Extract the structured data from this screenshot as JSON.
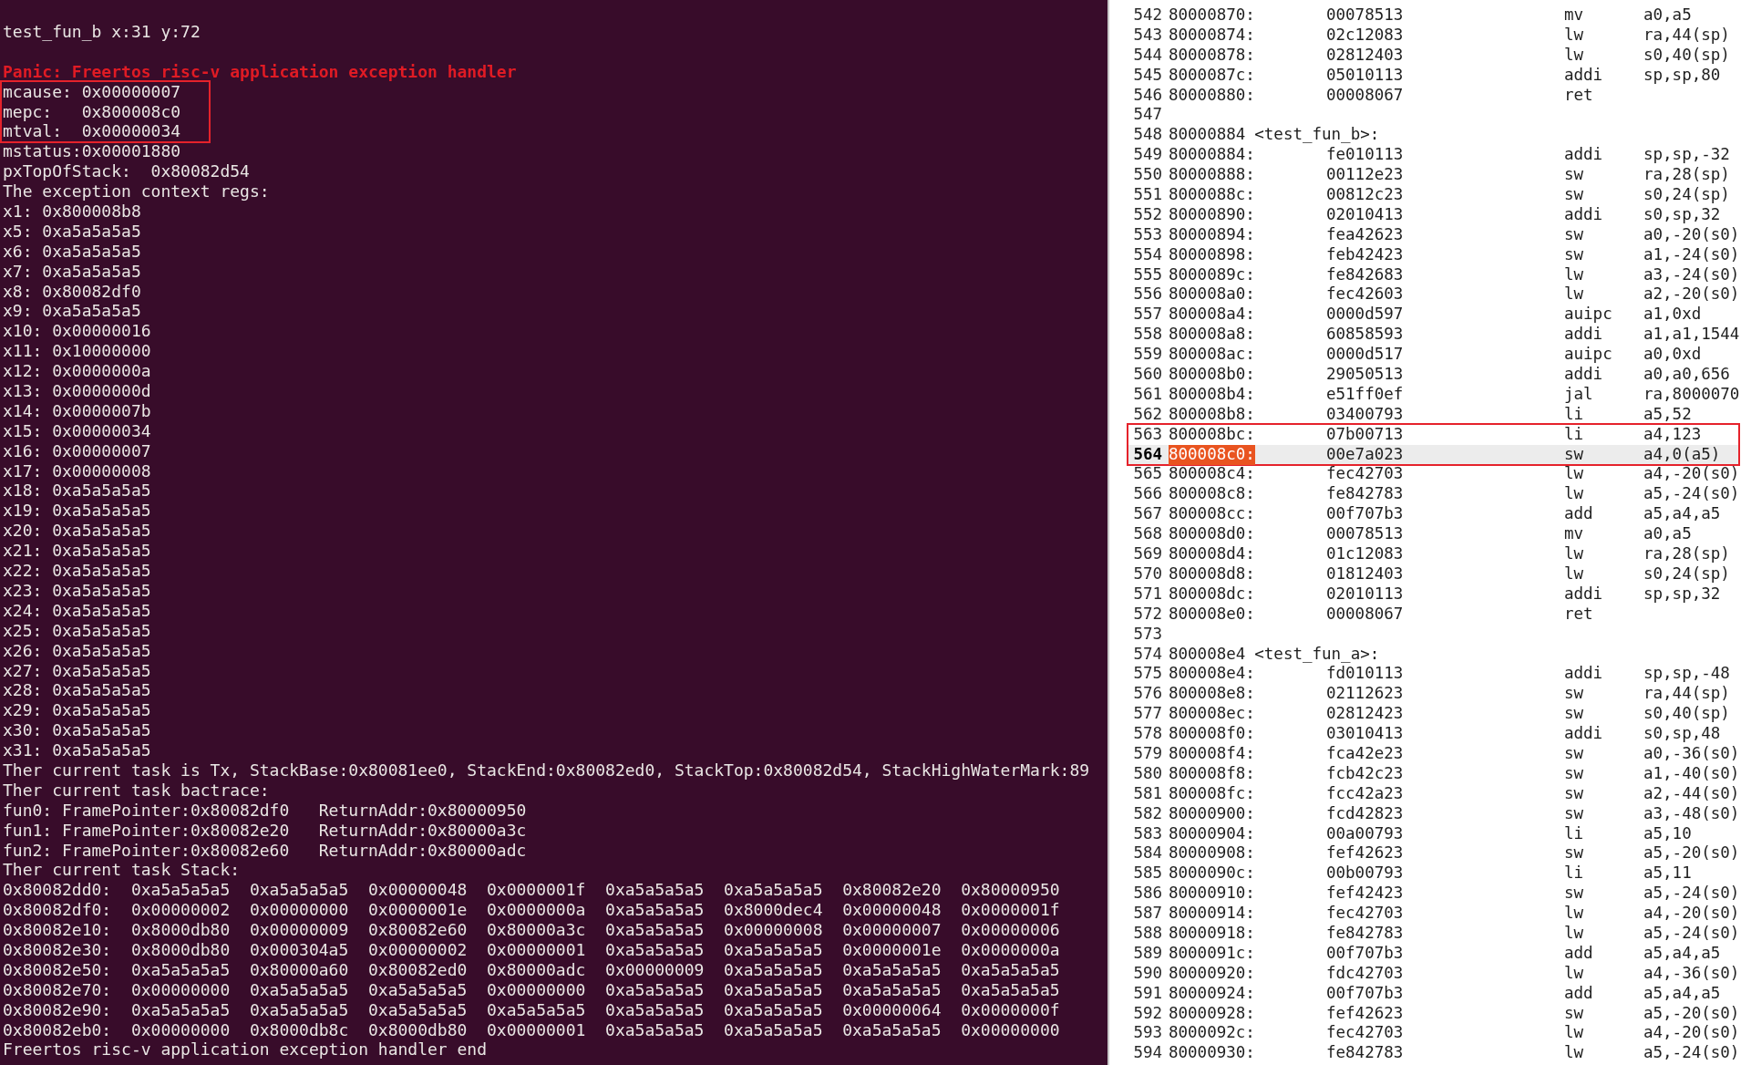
{
  "terminal": {
    "lines": [
      {
        "kind": "plain",
        "text": "test_fun_b x:31 y:72"
      },
      {
        "kind": "blank"
      },
      {
        "kind": "error",
        "text": "Panic: Freertos risc-v application exception handler"
      },
      {
        "kind": "frame",
        "lines": [
          {
            "kind": "plain",
            "text": "mcause: 0x00000007"
          },
          {
            "kind": "plain",
            "text": "mepc:   0x800008c0"
          },
          {
            "kind": "plain",
            "text": "mtval:  0x00000034"
          }
        ]
      },
      {
        "kind": "plain",
        "text": "mstatus:0x00001880"
      },
      {
        "kind": "plain",
        "text": "pxTopOfStack:  0x80082d54"
      },
      {
        "kind": "plain",
        "text": "The exception context regs:"
      },
      {
        "kind": "plain",
        "text": "x1: 0x800008b8"
      },
      {
        "kind": "plain",
        "text": "x5: 0xa5a5a5a5"
      },
      {
        "kind": "plain",
        "text": "x6: 0xa5a5a5a5"
      },
      {
        "kind": "plain",
        "text": "x7: 0xa5a5a5a5"
      },
      {
        "kind": "plain",
        "text": "x8: 0x80082df0"
      },
      {
        "kind": "plain",
        "text": "x9: 0xa5a5a5a5"
      },
      {
        "kind": "plain",
        "text": "x10: 0x00000016"
      },
      {
        "kind": "plain",
        "text": "x11: 0x10000000"
      },
      {
        "kind": "plain",
        "text": "x12: 0x0000000a"
      },
      {
        "kind": "plain",
        "text": "x13: 0x0000000d"
      },
      {
        "kind": "plain",
        "text": "x14: 0x0000007b"
      },
      {
        "kind": "plain",
        "text": "x15: 0x00000034"
      },
      {
        "kind": "plain",
        "text": "x16: 0x00000007"
      },
      {
        "kind": "plain",
        "text": "x17: 0x00000008"
      },
      {
        "kind": "plain",
        "text": "x18: 0xa5a5a5a5"
      },
      {
        "kind": "plain",
        "text": "x19: 0xa5a5a5a5"
      },
      {
        "kind": "plain",
        "text": "x20: 0xa5a5a5a5"
      },
      {
        "kind": "plain",
        "text": "x21: 0xa5a5a5a5"
      },
      {
        "kind": "plain",
        "text": "x22: 0xa5a5a5a5"
      },
      {
        "kind": "plain",
        "text": "x23: 0xa5a5a5a5"
      },
      {
        "kind": "plain",
        "text": "x24: 0xa5a5a5a5"
      },
      {
        "kind": "plain",
        "text": "x25: 0xa5a5a5a5"
      },
      {
        "kind": "plain",
        "text": "x26: 0xa5a5a5a5"
      },
      {
        "kind": "plain",
        "text": "x27: 0xa5a5a5a5"
      },
      {
        "kind": "plain",
        "text": "x28: 0xa5a5a5a5"
      },
      {
        "kind": "plain",
        "text": "x29: 0xa5a5a5a5"
      },
      {
        "kind": "plain",
        "text": "x30: 0xa5a5a5a5"
      },
      {
        "kind": "plain",
        "text": "x31: 0xa5a5a5a5"
      },
      {
        "kind": "plain",
        "text": "Ther current task is Tx, StackBase:0x80081ee0, StackEnd:0x80082ed0, StackTop:0x80082d54, StackHighWaterMark:89"
      },
      {
        "kind": "plain",
        "text": "Ther current task bactrace:"
      },
      {
        "kind": "plain",
        "text": "fun0: FramePointer:0x80082df0   ReturnAddr:0x80000950"
      },
      {
        "kind": "plain",
        "text": "fun1: FramePointer:0x80082e20   ReturnAddr:0x80000a3c"
      },
      {
        "kind": "plain",
        "text": "fun2: FramePointer:0x80082e60   ReturnAddr:0x80000adc"
      },
      {
        "kind": "plain",
        "text": "Ther current task Stack:"
      },
      {
        "kind": "plain",
        "text": "0x80082dd0:  0xa5a5a5a5  0xa5a5a5a5  0x00000048  0x0000001f  0xa5a5a5a5  0xa5a5a5a5  0x80082e20  0x80000950"
      },
      {
        "kind": "plain",
        "text": "0x80082df0:  0x00000002  0x00000000  0x0000001e  0x0000000a  0xa5a5a5a5  0x8000dec4  0x00000048  0x0000001f"
      },
      {
        "kind": "plain",
        "text": "0x80082e10:  0x8000db80  0x00000009  0x80082e60  0x80000a3c  0xa5a5a5a5  0x00000008  0x00000007  0x00000006"
      },
      {
        "kind": "plain",
        "text": "0x80082e30:  0x8000db80  0x000304a5  0x00000002  0x00000001  0xa5a5a5a5  0xa5a5a5a5  0x0000001e  0x0000000a"
      },
      {
        "kind": "plain",
        "text": "0x80082e50:  0xa5a5a5a5  0x80000a60  0x80082ed0  0x80000adc  0x00000009  0xa5a5a5a5  0xa5a5a5a5  0xa5a5a5a5"
      },
      {
        "kind": "plain",
        "text": "0x80082e70:  0x00000000  0xa5a5a5a5  0xa5a5a5a5  0x00000000  0xa5a5a5a5  0xa5a5a5a5  0xa5a5a5a5  0xa5a5a5a5"
      },
      {
        "kind": "plain",
        "text": "0x80082e90:  0xa5a5a5a5  0xa5a5a5a5  0xa5a5a5a5  0xa5a5a5a5  0xa5a5a5a5  0xa5a5a5a5  0x00000064  0x0000000f"
      },
      {
        "kind": "plain",
        "text": "0x80082eb0:  0x00000000  0x8000db8c  0x8000db80  0x00000001  0xa5a5a5a5  0xa5a5a5a5  0xa5a5a5a5  0x00000000"
      },
      {
        "kind": "plain",
        "text": "Freertos risc-v application exception handler end"
      }
    ]
  },
  "disassembly": {
    "rows": [
      {
        "kind": "code",
        "n": "542",
        "addr": "80000870:",
        "hex": "00078513",
        "op": "mv",
        "args": "a0,a5",
        "current": false
      },
      {
        "kind": "code",
        "n": "543",
        "addr": "80000874:",
        "hex": "02c12083",
        "op": "lw",
        "args": "ra,44(sp)",
        "current": false
      },
      {
        "kind": "code",
        "n": "544",
        "addr": "80000878:",
        "hex": "02812403",
        "op": "lw",
        "args": "s0,40(sp)",
        "current": false
      },
      {
        "kind": "code",
        "n": "545",
        "addr": "8000087c:",
        "hex": "05010113",
        "op": "addi",
        "args": "sp,sp,80",
        "current": false
      },
      {
        "kind": "code",
        "n": "546",
        "addr": "80000880:",
        "hex": "00008067",
        "op": "ret",
        "current": false
      },
      {
        "kind": "blank",
        "n": "547",
        "current": false
      },
      {
        "kind": "label",
        "n": "548",
        "addr": "80000884",
        "label": "<test_fun_b>:",
        "current": false
      },
      {
        "kind": "code",
        "n": "549",
        "addr": "80000884:",
        "hex": "fe010113",
        "op": "addi",
        "args": "sp,sp,-32",
        "current": false
      },
      {
        "kind": "code",
        "n": "550",
        "addr": "80000888:",
        "hex": "00112e23",
        "op": "sw",
        "args": "ra,28(sp)",
        "current": false
      },
      {
        "kind": "code",
        "n": "551",
        "addr": "8000088c:",
        "hex": "00812c23",
        "op": "sw",
        "args": "s0,24(sp)",
        "current": false
      },
      {
        "kind": "code",
        "n": "552",
        "addr": "80000890:",
        "hex": "02010413",
        "op": "addi",
        "args": "s0,sp,32",
        "current": false
      },
      {
        "kind": "code",
        "n": "553",
        "addr": "80000894:",
        "hex": "fea42623",
        "op": "sw",
        "args": "a0,-20(s0)",
        "current": false
      },
      {
        "kind": "code",
        "n": "554",
        "addr": "80000898:",
        "hex": "feb42423",
        "op": "sw",
        "args": "a1,-24(s0)",
        "current": false
      },
      {
        "kind": "code",
        "n": "555",
        "addr": "8000089c:",
        "hex": "fe842683",
        "op": "lw",
        "args": "a3,-24(s0)",
        "current": false
      },
      {
        "kind": "code",
        "n": "556",
        "addr": "800008a0:",
        "hex": "fec42603",
        "op": "lw",
        "args": "a2,-20(s0)",
        "current": false
      },
      {
        "kind": "code",
        "n": "557",
        "addr": "800008a4:",
        "hex": "0000d597",
        "op": "auipc",
        "args": "a1,0xd",
        "current": false
      },
      {
        "kind": "code",
        "n": "558",
        "addr": "800008a8:",
        "hex": "60858593",
        "op": "addi",
        "args": "a1,a1,1544",
        "current": false
      },
      {
        "kind": "code",
        "n": "559",
        "addr": "800008ac:",
        "hex": "0000d517",
        "op": "auipc",
        "args": "a0,0xd",
        "current": false
      },
      {
        "kind": "code",
        "n": "560",
        "addr": "800008b0:",
        "hex": "29050513",
        "op": "addi",
        "args": "a0,a0,656",
        "current": false
      },
      {
        "kind": "code",
        "n": "561",
        "addr": "800008b4:",
        "hex": "e51ff0ef",
        "op": "jal",
        "args": "ra,8000070",
        "current": false
      },
      {
        "kind": "code",
        "n": "562",
        "addr": "800008b8:",
        "hex": "03400793",
        "op": "li",
        "args": "a5,52",
        "current": false
      },
      {
        "kind": "frame",
        "rows": [
          {
            "kind": "code",
            "n": "563",
            "addr": "800008bc:",
            "hex": "07b00713",
            "op": "li",
            "args": "a4,123",
            "current": false
          },
          {
            "kind": "code",
            "n": "564",
            "addr": "800008c0:",
            "hex": "00e7a023",
            "op": "sw",
            "args": "a4,0(a5)",
            "current": true
          }
        ]
      },
      {
        "kind": "code",
        "n": "565",
        "addr": "800008c4:",
        "hex": "fec42703",
        "op": "lw",
        "args": "a4,-20(s0)",
        "current": false
      },
      {
        "kind": "code",
        "n": "566",
        "addr": "800008c8:",
        "hex": "fe842783",
        "op": "lw",
        "args": "a5,-24(s0)",
        "current": false
      },
      {
        "kind": "code",
        "n": "567",
        "addr": "800008cc:",
        "hex": "00f707b3",
        "op": "add",
        "args": "a5,a4,a5",
        "current": false
      },
      {
        "kind": "code",
        "n": "568",
        "addr": "800008d0:",
        "hex": "00078513",
        "op": "mv",
        "args": "a0,a5",
        "current": false
      },
      {
        "kind": "code",
        "n": "569",
        "addr": "800008d4:",
        "hex": "01c12083",
        "op": "lw",
        "args": "ra,28(sp)",
        "current": false
      },
      {
        "kind": "code",
        "n": "570",
        "addr": "800008d8:",
        "hex": "01812403",
        "op": "lw",
        "args": "s0,24(sp)",
        "current": false
      },
      {
        "kind": "code",
        "n": "571",
        "addr": "800008dc:",
        "hex": "02010113",
        "op": "addi",
        "args": "sp,sp,32",
        "current": false
      },
      {
        "kind": "code",
        "n": "572",
        "addr": "800008e0:",
        "hex": "00008067",
        "op": "ret",
        "current": false
      },
      {
        "kind": "blank",
        "n": "573",
        "current": false
      },
      {
        "kind": "label",
        "n": "574",
        "addr": "800008e4",
        "label": "<test_fun_a>:",
        "current": false
      },
      {
        "kind": "code",
        "n": "575",
        "addr": "800008e4:",
        "hex": "fd010113",
        "op": "addi",
        "args": "sp,sp,-48",
        "current": false
      },
      {
        "kind": "code",
        "n": "576",
        "addr": "800008e8:",
        "hex": "02112623",
        "op": "sw",
        "args": "ra,44(sp)",
        "current": false
      },
      {
        "kind": "code",
        "n": "577",
        "addr": "800008ec:",
        "hex": "02812423",
        "op": "sw",
        "args": "s0,40(sp)",
        "current": false
      },
      {
        "kind": "code",
        "n": "578",
        "addr": "800008f0:",
        "hex": "03010413",
        "op": "addi",
        "args": "s0,sp,48",
        "current": false
      },
      {
        "kind": "code",
        "n": "579",
        "addr": "800008f4:",
        "hex": "fca42e23",
        "op": "sw",
        "args": "a0,-36(s0)",
        "current": false
      },
      {
        "kind": "code",
        "n": "580",
        "addr": "800008f8:",
        "hex": "fcb42c23",
        "op": "sw",
        "args": "a1,-40(s0)",
        "current": false
      },
      {
        "kind": "code",
        "n": "581",
        "addr": "800008fc:",
        "hex": "fcc42a23",
        "op": "sw",
        "args": "a2,-44(s0)",
        "current": false
      },
      {
        "kind": "code",
        "n": "582",
        "addr": "80000900:",
        "hex": "fcd42823",
        "op": "sw",
        "args": "a3,-48(s0)",
        "current": false
      },
      {
        "kind": "code",
        "n": "583",
        "addr": "80000904:",
        "hex": "00a00793",
        "op": "li",
        "args": "a5,10",
        "current": false
      },
      {
        "kind": "code",
        "n": "584",
        "addr": "80000908:",
        "hex": "fef42623",
        "op": "sw",
        "args": "a5,-20(s0)",
        "current": false
      },
      {
        "kind": "code",
        "n": "585",
        "addr": "8000090c:",
        "hex": "00b00793",
        "op": "li",
        "args": "a5,11",
        "current": false
      },
      {
        "kind": "code",
        "n": "586",
        "addr": "80000910:",
        "hex": "fef42423",
        "op": "sw",
        "args": "a5,-24(s0)",
        "current": false
      },
      {
        "kind": "code",
        "n": "587",
        "addr": "80000914:",
        "hex": "fec42703",
        "op": "lw",
        "args": "a4,-20(s0)",
        "current": false
      },
      {
        "kind": "code",
        "n": "588",
        "addr": "80000918:",
        "hex": "fe842783",
        "op": "lw",
        "args": "a5,-24(s0)",
        "current": false
      },
      {
        "kind": "code",
        "n": "589",
        "addr": "8000091c:",
        "hex": "00f707b3",
        "op": "add",
        "args": "a5,a4,a5",
        "current": false
      },
      {
        "kind": "code",
        "n": "590",
        "addr": "80000920:",
        "hex": "fdc42703",
        "op": "lw",
        "args": "a4,-36(s0)",
        "current": false
      },
      {
        "kind": "code",
        "n": "591",
        "addr": "80000924:",
        "hex": "00f707b3",
        "op": "add",
        "args": "a5,a4,a5",
        "current": false
      },
      {
        "kind": "code",
        "n": "592",
        "addr": "80000928:",
        "hex": "fef42623",
        "op": "sw",
        "args": "a5,-20(s0)",
        "current": false
      },
      {
        "kind": "code",
        "n": "593",
        "addr": "8000092c:",
        "hex": "fec42703",
        "op": "lw",
        "args": "a4,-20(s0)",
        "current": false
      },
      {
        "kind": "code",
        "n": "594",
        "addr": "80000930:",
        "hex": "fe842783",
        "op": "lw",
        "args": "a5,-24(s0)",
        "current": false
      }
    ]
  }
}
